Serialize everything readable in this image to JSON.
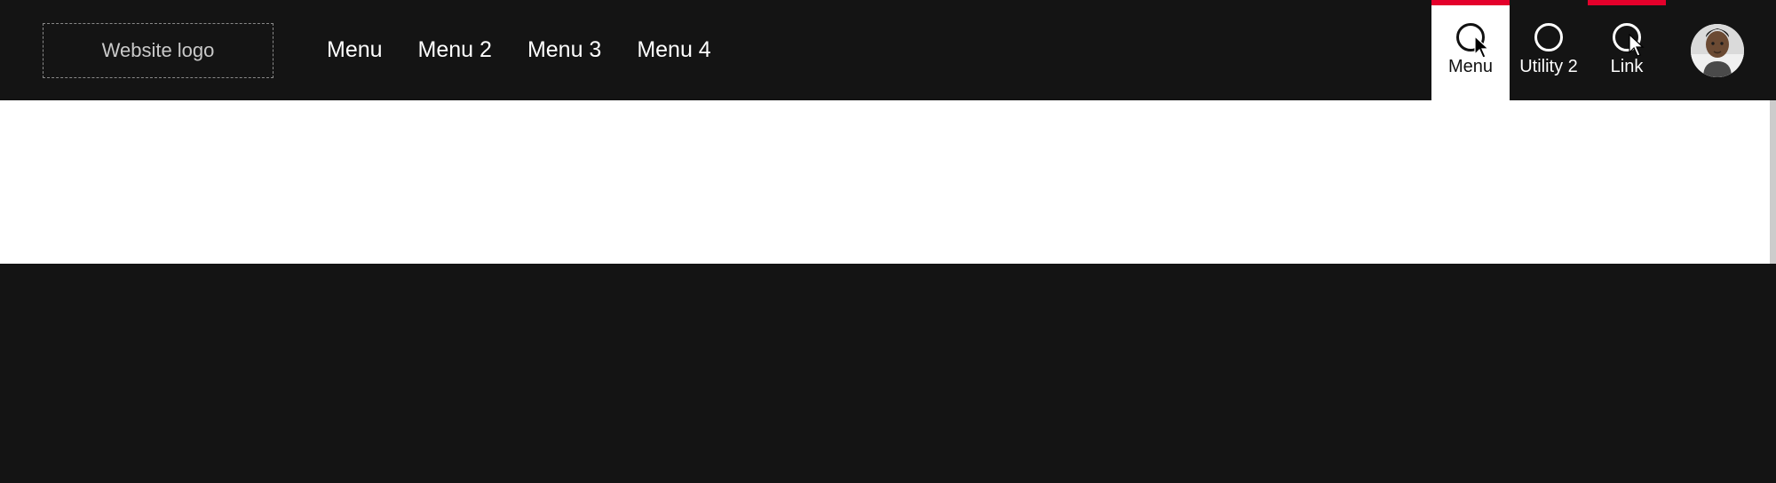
{
  "header": {
    "logo_label": "Website logo",
    "menu": [
      "Menu",
      "Menu 2",
      "Menu 3",
      "Menu 4"
    ],
    "utility": [
      {
        "label": "Menu",
        "active": true,
        "accent": true
      },
      {
        "label": "Utility 2",
        "active": false,
        "accent": false
      },
      {
        "label": "Link",
        "active": false,
        "accent": true
      }
    ]
  },
  "colors": {
    "accent": "#e4002b",
    "bg_dark": "#141414"
  }
}
